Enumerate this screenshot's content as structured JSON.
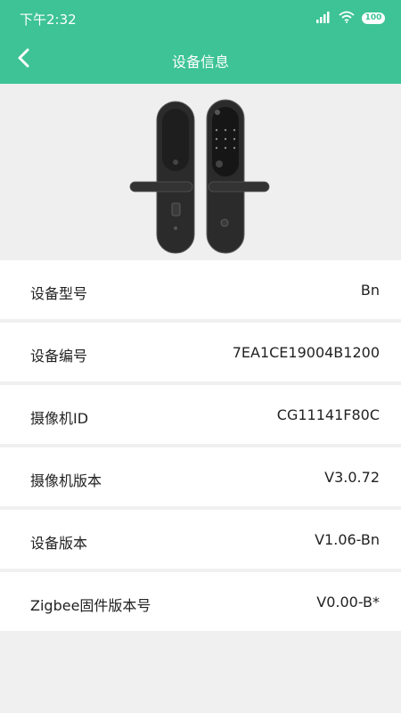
{
  "status_bar": {
    "time": "下午2:32",
    "battery": "100",
    "icons": [
      "signal-icon",
      "wifi-icon",
      "battery-icon"
    ]
  },
  "nav": {
    "title": "设备信息",
    "back_icon": "chevron-left-icon"
  },
  "device_image": "smart-door-lock",
  "colors": {
    "accent": "#3dc396",
    "background": "#f0f0f0",
    "row_background": "#ffffff",
    "text": "#222222"
  },
  "info": [
    {
      "label": "设备型号",
      "value": "Bn"
    },
    {
      "label": "设备编号",
      "value": "7EA1CE19004B1200"
    },
    {
      "label": "摄像机ID",
      "value": "CG11141F80C"
    },
    {
      "label": "摄像机版本",
      "value": "V3.0.72"
    },
    {
      "label": "设备版本",
      "value": "V1.06-Bn"
    },
    {
      "label": "Zigbee固件版本号",
      "value": "V0.00-B*"
    }
  ]
}
